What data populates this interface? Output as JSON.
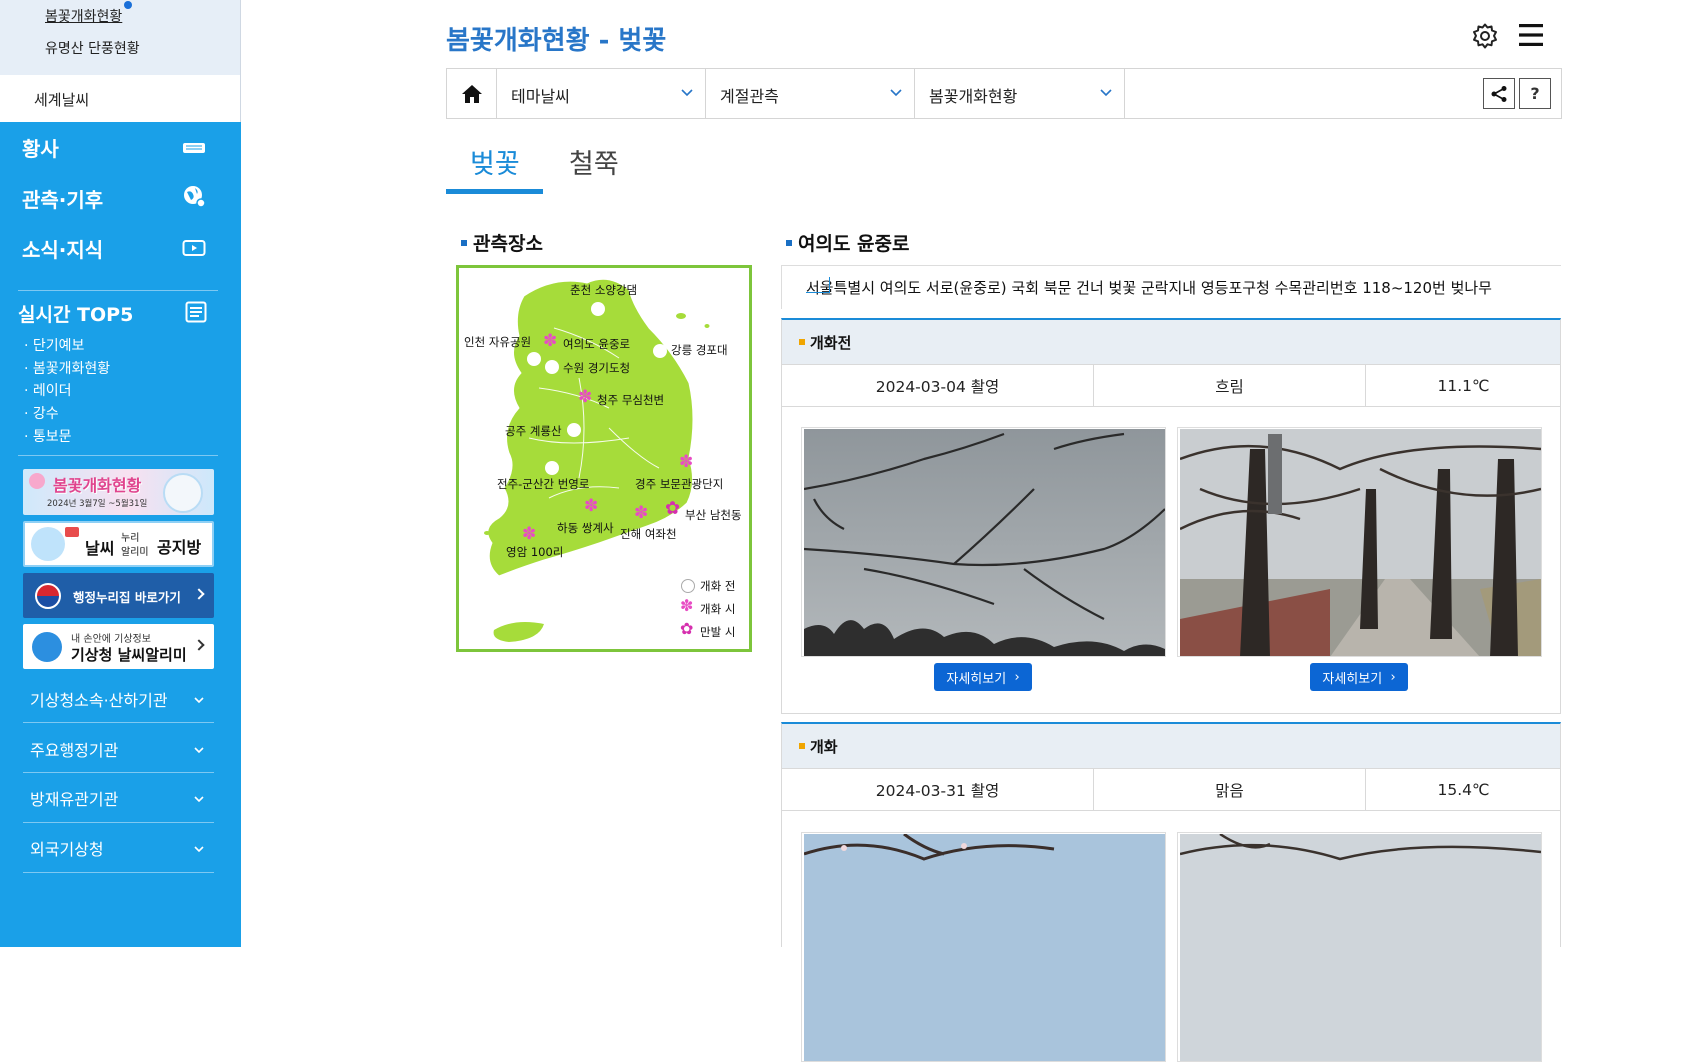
{
  "sidebar": {
    "sub_links": [
      "봄꽃개화현황",
      "유명산 단풍현황"
    ],
    "world_weather": "세계날씨",
    "menus": [
      {
        "label": "황사",
        "icon": "dust-icon"
      },
      {
        "label": "관측·기후",
        "icon": "globe-icon"
      },
      {
        "label": "소식·지식",
        "icon": "video-icon"
      }
    ],
    "top5_title": "실시간 TOP5",
    "top5_items": [
      "· 단기예보",
      "· 봄꽃개화현황",
      "· 레이더",
      "· 강수",
      "· 통보문"
    ],
    "banners": {
      "spring": {
        "title": "봄꽃개화현황",
        "dates": "2024년 3월7일 ~5월31일"
      },
      "notice": {
        "a": "날씨",
        "b": "누리",
        "c": "알리미",
        "d": "공지방"
      },
      "gov": "행정누리집 바로가기",
      "alert": {
        "small": "내 손안에 기상정보",
        "big": "기상청 날씨알리미"
      }
    },
    "institutions": [
      "기상청소속·산하기관",
      "주요행정기관",
      "방재유관기관",
      "외국기상청"
    ]
  },
  "header": {
    "title": "봄꽃개화현황 - 벚꽃"
  },
  "nav": {
    "dropdowns": [
      "테마날씨",
      "계절관측",
      "봄꽃개화현황"
    ],
    "help": "?"
  },
  "tabs": [
    {
      "label": "벚꽃",
      "active": true
    },
    {
      "label": "철쭉",
      "active": false
    }
  ],
  "map_section": {
    "title": "관측장소",
    "sites": [
      {
        "name": "춘천 소양강댐",
        "status": "before"
      },
      {
        "name": "인천 자유공원",
        "status": "before"
      },
      {
        "name": "여의도 윤중로",
        "status": "bloom"
      },
      {
        "name": "수원 경기도청",
        "status": "before"
      },
      {
        "name": "강릉 경포대",
        "status": "before"
      },
      {
        "name": "청주 무심천변",
        "status": "bloom"
      },
      {
        "name": "공주 계룡산",
        "status": "before"
      },
      {
        "name": "전주-군산간 번영로",
        "status": "before"
      },
      {
        "name": "경주 보문관광단지",
        "status": "bloom"
      },
      {
        "name": "하동 쌍계사",
        "status": "bloom"
      },
      {
        "name": "부산 남천동",
        "status": "full"
      },
      {
        "name": "진해 여좌천",
        "status": "bloom"
      },
      {
        "name": "영암 100리",
        "status": "bloom"
      }
    ],
    "legend": [
      "개화 전",
      "개화 시",
      "만발 시"
    ],
    "colors": {
      "land": "#a6dc3a",
      "border": "#7dc53b",
      "bloom": "#e84cc4",
      "full": "#d62fae"
    }
  },
  "detail": {
    "title": "여의도 윤중로",
    "address": "서울특별시 여의도 서로(윤중로) 국회 북문 건너 벚꽃 군락지내 영등포구청 수목관리번호 118~120번 벚나무",
    "stages": [
      {
        "name": "개화전",
        "date": "2024-03-04 촬영",
        "weather": "흐림",
        "temp": "11.1℃",
        "buttons": [
          "자세히보기",
          "자세히보기"
        ]
      },
      {
        "name": "개화",
        "date": "2024-03-31 촬영",
        "weather": "맑음",
        "temp": "15.4℃"
      }
    ]
  }
}
